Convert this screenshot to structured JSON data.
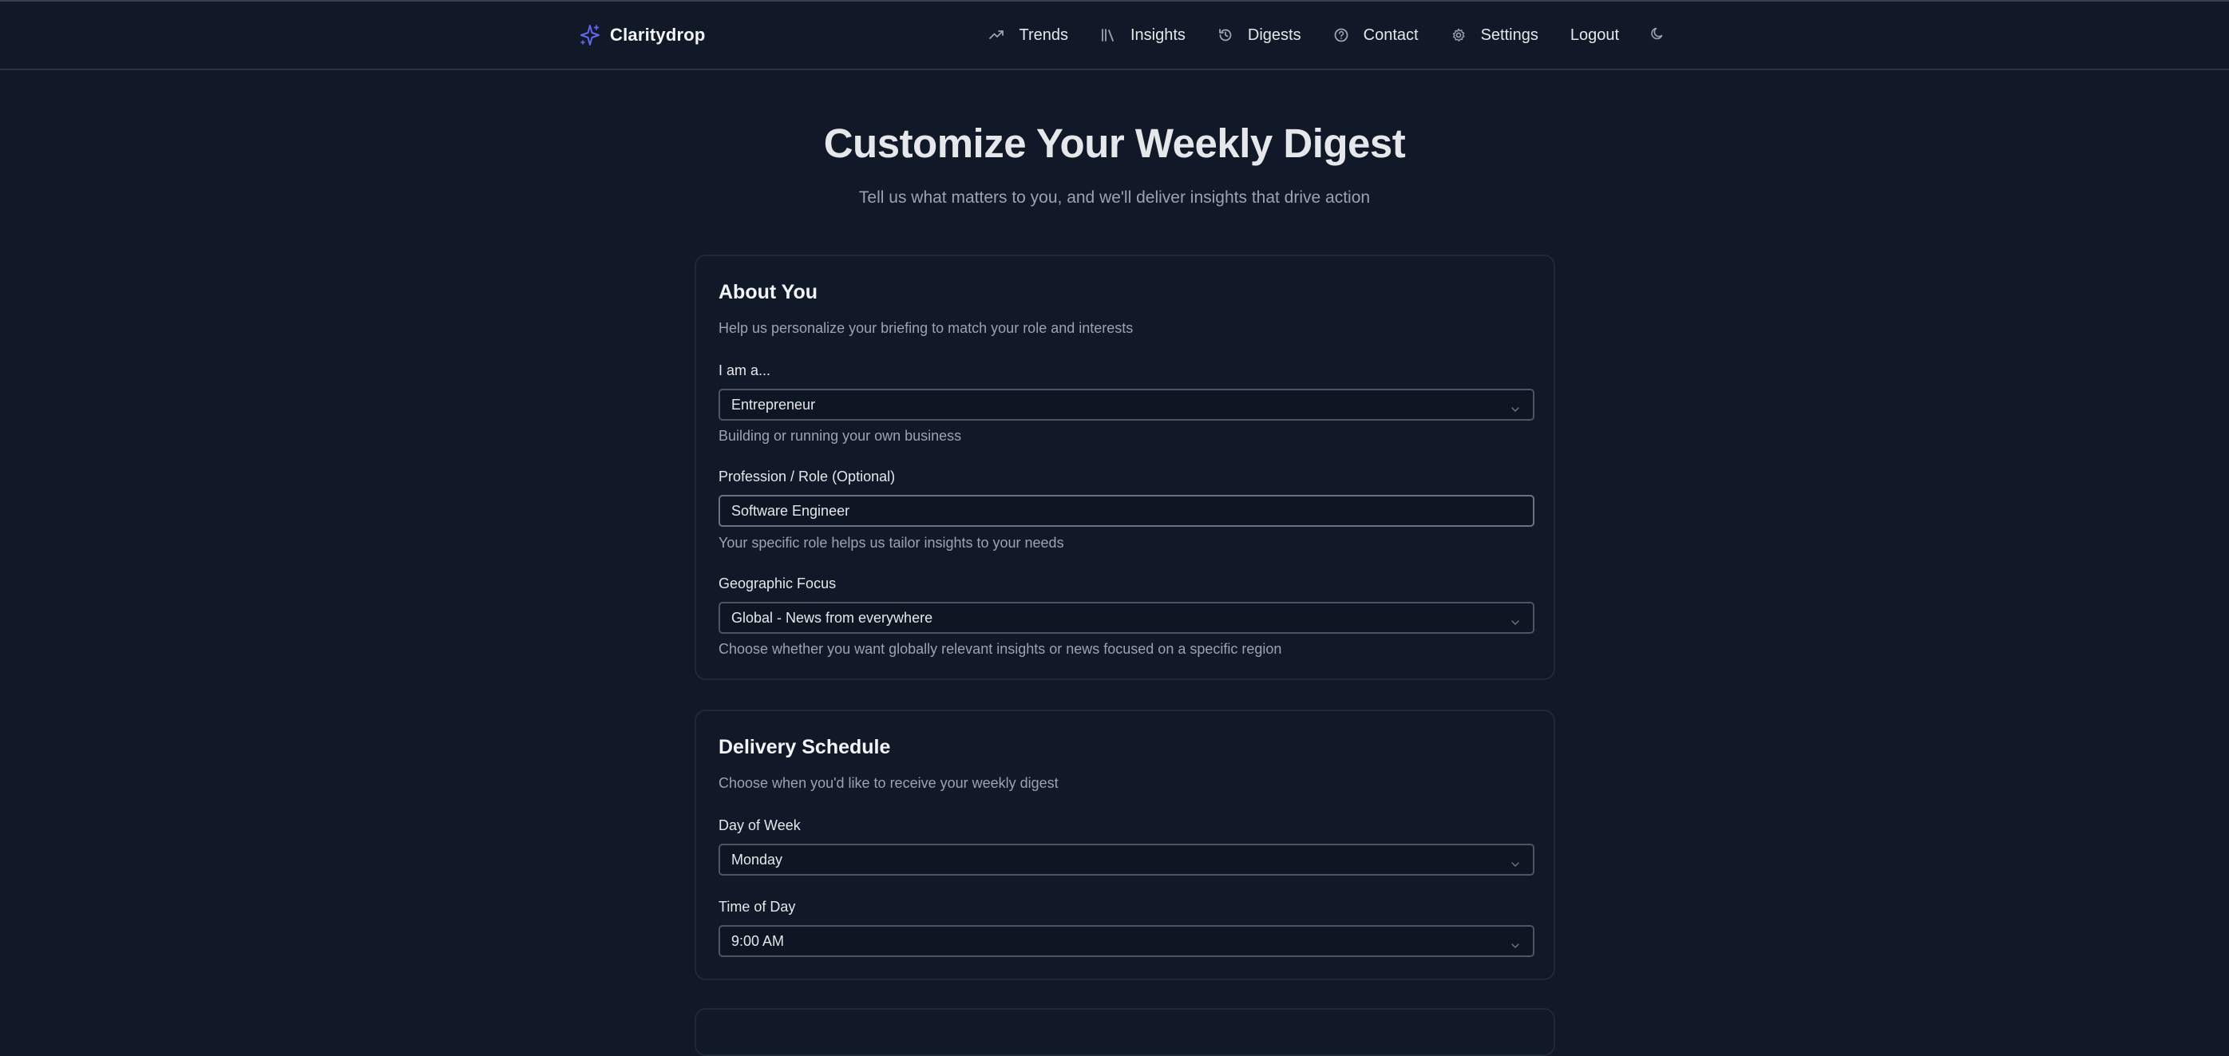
{
  "brand": {
    "name": "Claritydrop",
    "accent": "#6366f1"
  },
  "nav": {
    "items": [
      {
        "label": "Trends",
        "icon": "trending-up-icon"
      },
      {
        "label": "Insights",
        "icon": "library-icon"
      },
      {
        "label": "Digests",
        "icon": "history-icon"
      },
      {
        "label": "Contact",
        "icon": "help-circle-icon"
      },
      {
        "label": "Settings",
        "icon": "gear-icon"
      },
      {
        "label": "Logout"
      }
    ],
    "theme_icon": "moon-icon"
  },
  "hero": {
    "title": "Customize Your Weekly Digest",
    "subtitle": "Tell us what matters to you, and we'll deliver insights that drive action"
  },
  "about": {
    "title": "About You",
    "description": "Help us personalize your briefing to match your role and interests",
    "role": {
      "label": "I am a...",
      "value": "Entrepreneur",
      "hint": "Building or running your own business"
    },
    "profession": {
      "label": "Profession / Role (Optional)",
      "value": "Software Engineer",
      "hint": "Your specific role helps us tailor insights to your needs"
    },
    "geo": {
      "label": "Geographic Focus",
      "value": "Global - News from everywhere",
      "hint": "Choose whether you want globally relevant insights or news focused on a specific region"
    }
  },
  "schedule": {
    "title": "Delivery Schedule",
    "description": "Choose when you'd like to receive your weekly digest",
    "day": {
      "label": "Day of Week",
      "value": "Monday"
    },
    "time": {
      "label": "Time of Day",
      "value": "9:00 AM"
    }
  }
}
